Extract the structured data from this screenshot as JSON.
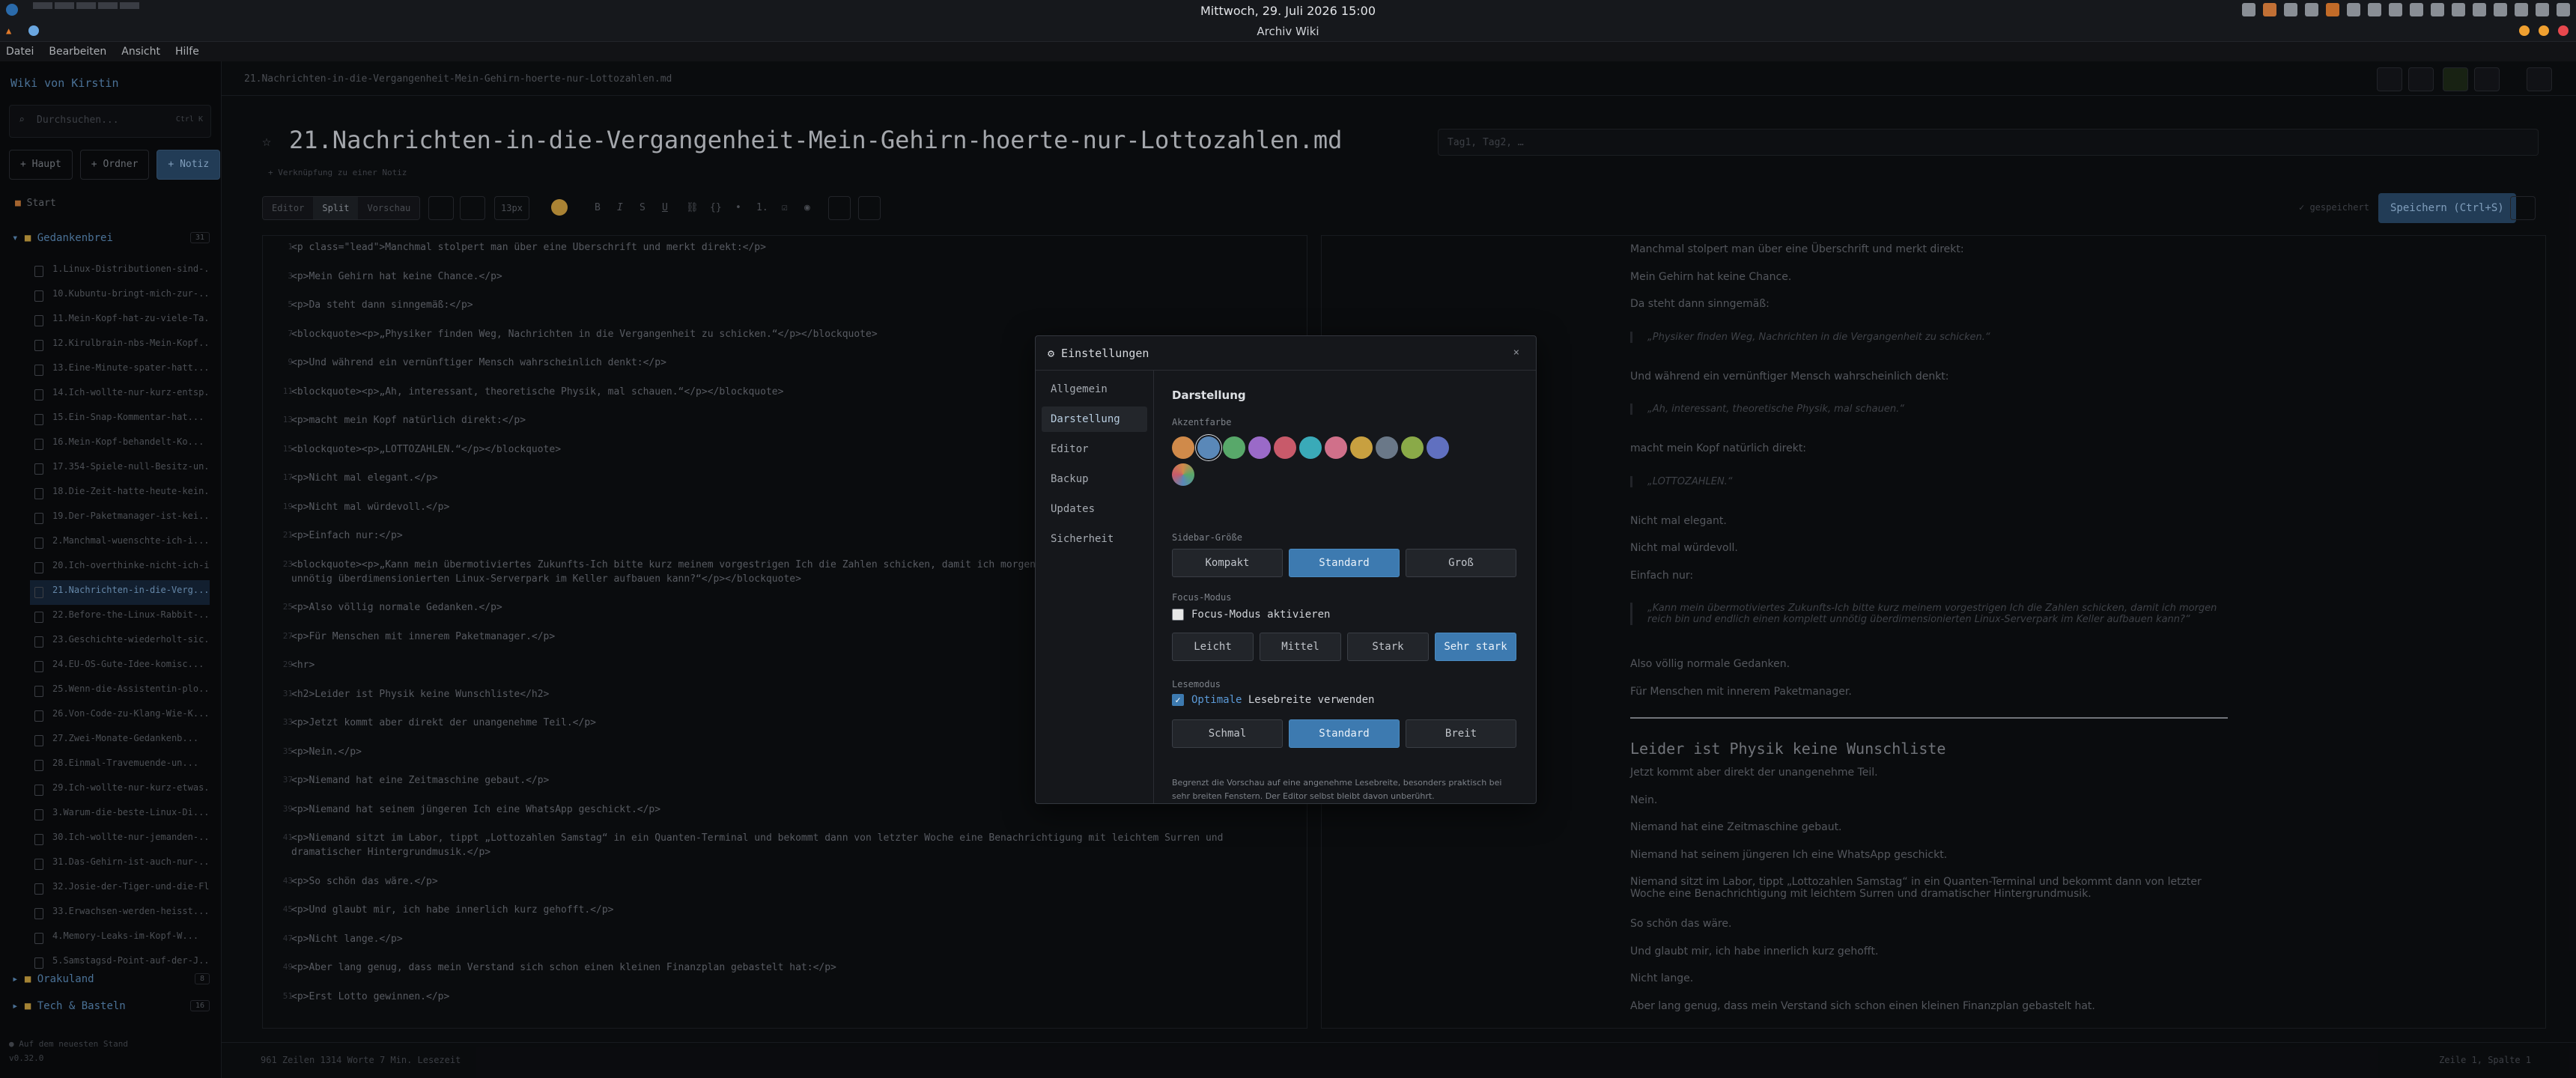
{
  "system": {
    "clock": "Mittwoch, 29. Juli 2026 15:00"
  },
  "window": {
    "title": "Archiv Wiki"
  },
  "menu": [
    "Datei",
    "Bearbeiten",
    "Ansicht",
    "Hilfe"
  ],
  "sidebar": {
    "wiki_title": "Wiki von Kirstin",
    "search_placeholder": "Durchsuchen...",
    "search_shortcut": "Ctrl K",
    "buttons": [
      "+ Haupt",
      "+ Ordner",
      "+ Notiz"
    ],
    "start": "Start",
    "groups": [
      {
        "name": "Gedankenbrei",
        "count": "31"
      },
      {
        "name": "Orakuland",
        "count": "8"
      },
      {
        "name": "Tech & Basteln",
        "count": "16"
      }
    ],
    "files": [
      "1.Linux-Distributionen-sind-...",
      "10.Kubuntu-bringt-mich-zur-...",
      "11.Mein-Kopf-hat-zu-viele-Ta...",
      "12.Kirulbrain-nbs-Mein-Kopf...",
      "13.Eine-Minute-spater-hatt...",
      "14.Ich-wollte-nur-kurz-entsp...",
      "15.Ein-Snap-Kommentar-hat...",
      "16.Mein-Kopf-behandelt-Ko...",
      "17.354-Spiele-null-Besitz-un...",
      "18.Die-Zeit-hatte-heute-kein...",
      "19.Der-Paketmanager-ist-kei...",
      "2.Manchmal-wuenschte-ich-i...",
      "20.Ich-overthinke-nicht-ich-i...",
      "21.Nachrichten-in-die-Verg...",
      "22.Before-the-Linux-Rabbit-...",
      "23.Geschichte-wiederholt-sic...",
      "24.EU-OS-Gute-Idee-komisc...",
      "25.Wenn-die-Assistentin-plo...",
      "26.Von-Code-zu-Klang-Wie-K...",
      "27.Zwei-Monate-Gedankenb...",
      "28.Einmal-Travemuende-un...",
      "29.Ich-wollte-nur-kurz-etwas...",
      "3.Warum-die-beste-Linux-Di...",
      "30.Ich-wollte-nur-jemanden-...",
      "31.Das-Gehirn-ist-auch-nur-...",
      "32.Josie-der-Tiger-und-die-Fl...",
      "33.Erwachsen-werden-heisst...",
      "4.Memory-Leaks-im-Kopf-W...",
      "5.Samstagsd-Point-auf-der-J..."
    ],
    "footer": [
      "● Auf dem neuesten Stand",
      "v0.32.0"
    ]
  },
  "editor": {
    "breadcrumb": "21.Nachrichten-in-die-Vergangenheit-Mein-Gehirn-hoerte-nur-Lottozahlen.md",
    "title": "21.Nachrichten-in-die-Vergangenheit-Mein-Gehirn-hoerte-nur-Lottozahlen.md",
    "tags_placeholder": "Tag1, Tag2, …",
    "backlink": "+ Verknüpfung zu einer Notiz",
    "modes": [
      "Editor",
      "Split",
      "Vorschau"
    ],
    "fontsize": "13px",
    "saved": "✓ gespeichert",
    "save_button": "Speichern (Ctrl+S)",
    "status_left": "961 Zeilen   1314 Worte   7 Min. Lesezeit",
    "status_right": "Zeile 1, Spalte 1"
  },
  "code_lines": [
    {
      "n": "1",
      "t": "<p class=\"lead\">Manchmal stolpert man über eine Überschrift und merkt direkt:</p>"
    },
    {
      "n": "3",
      "t": "<p>Mein Gehirn hat keine Chance.</p>"
    },
    {
      "n": "5",
      "t": "<p>Da steht dann sinngemäß:</p>"
    },
    {
      "n": "7",
      "t": "<blockquote><p>„Physiker finden Weg, Nachrichten in die Vergangenheit zu schicken.“</p></blockquote>"
    },
    {
      "n": "9",
      "t": "<p>Und während ein vernünftiger Mensch wahrscheinlich denkt:</p>"
    },
    {
      "n": "11",
      "t": "<blockquote><p>„Ah, interessant, theoretische Physik, mal schauen.“</p></blockquote>"
    },
    {
      "n": "13",
      "t": "<p>macht mein Kopf natürlich direkt:</p>"
    },
    {
      "n": "15",
      "t": "<blockquote><p>„LOTTOZAHLEN.“</p></blockquote>"
    },
    {
      "n": "17",
      "t": "<p>Nicht mal elegant.</p>"
    },
    {
      "n": "19",
      "t": "<p>Nicht mal würdevoll.</p>"
    },
    {
      "n": "21",
      "t": "<p>Einfach nur:</p>"
    },
    {
      "n": "23",
      "t": "<blockquote><p>„Kann mein übermotiviertes Zukunfts-Ich bitte kurz meinem vorgestrigen Ich die Zahlen schicken, damit ich morgen"
    },
    {
      "n": "",
      "t": "unnötig überdimensionierten Linux-Serverpark im Keller aufbauen kann?“</p></blockquote>"
    },
    {
      "n": "25",
      "t": "<p>Also völlig normale Gedanken.</p>"
    },
    {
      "n": "27",
      "t": "<p>Für Menschen mit innerem Paketmanager.</p>"
    },
    {
      "n": "29",
      "t": "<hr>"
    },
    {
      "n": "31",
      "t": "<h2>Leider ist Physik keine Wunschliste</h2>"
    },
    {
      "n": "33",
      "t": "<p>Jetzt kommt aber direkt der unangenehme Teil.</p>"
    },
    {
      "n": "35",
      "t": "<p>Nein.</p>"
    },
    {
      "n": "37",
      "t": "<p>Niemand hat eine Zeitmaschine gebaut.</p>"
    },
    {
      "n": "39",
      "t": "<p>Niemand hat seinem jüngeren Ich eine WhatsApp geschickt.</p>"
    },
    {
      "n": "41",
      "t": "<p>Niemand sitzt im Labor, tippt „Lottozahlen Samstag“ in ein Quanten-Terminal und bekommt dann von letzter Woche eine Benachrichtigung mit leichtem Surren und"
    },
    {
      "n": "",
      "t": "dramatischer Hintergrundmusik.</p>"
    },
    {
      "n": "43",
      "t": "<p>So schön das wäre.</p>"
    },
    {
      "n": "45",
      "t": "<p>Und glaubt mir, ich habe innerlich kurz gehofft.</p>"
    },
    {
      "n": "47",
      "t": "<p>Nicht lange.</p>"
    },
    {
      "n": "49",
      "t": "<p>Aber lang genug, dass mein Verstand sich schon einen kleinen Finanzplan gebastelt hat:</p>"
    },
    {
      "n": "51",
      "t": "<p>Erst Lotto gewinnen.</p>"
    }
  ],
  "preview": [
    {
      "k": "p",
      "t": "Manchmal stolpert man über eine Überschrift und merkt direkt:"
    },
    {
      "k": "p",
      "t": "Mein Gehirn hat keine Chance."
    },
    {
      "k": "p",
      "t": "Da steht dann sinngemäß:"
    },
    {
      "k": "bq",
      "t": "„Physiker finden Weg, Nachrichten in die Vergangenheit zu schicken.“"
    },
    {
      "k": "p",
      "t": "Und während ein vernünftiger Mensch wahrscheinlich denkt:"
    },
    {
      "k": "bq",
      "t": "„Ah, interessant, theoretische Physik, mal schauen.“"
    },
    {
      "k": "p",
      "t": "macht mein Kopf natürlich direkt:"
    },
    {
      "k": "bq",
      "t": "„LOTTOZAHLEN.“"
    },
    {
      "k": "p",
      "t": "Nicht mal elegant."
    },
    {
      "k": "p",
      "t": "Nicht mal würdevoll."
    },
    {
      "k": "p",
      "t": "Einfach nur:"
    },
    {
      "k": "bq",
      "t": "„Kann mein übermotiviertes Zukunfts-Ich bitte kurz meinem vorgestrigen Ich die Zahlen schicken, damit ich morgen reich bin und endlich einen komplett unnötig überdimensionierten Linux-Serverpark im Keller aufbauen kann?“"
    },
    {
      "k": "p",
      "t": "Also völlig normale Gedanken."
    },
    {
      "k": "p",
      "t": "Für Menschen mit innerem Paketmanager."
    },
    {
      "k": "h2",
      "t": "Leider ist Physik keine Wunschliste"
    },
    {
      "k": "p",
      "t": "Jetzt kommt aber direkt der unangenehme Teil."
    },
    {
      "k": "p",
      "t": "Nein."
    },
    {
      "k": "p",
      "t": "Niemand hat eine Zeitmaschine gebaut."
    },
    {
      "k": "p",
      "t": "Niemand hat seinem jüngeren Ich eine WhatsApp geschickt."
    },
    {
      "k": "p",
      "t": "Niemand sitzt im Labor, tippt „Lottozahlen Samstag“ in ein Quanten-Terminal und bekommt dann von letzter Woche eine Benachrichtigung mit leichtem Surren und dramatischer Hintergrundmusik."
    },
    {
      "k": "p",
      "t": "So schön das wäre."
    },
    {
      "k": "p",
      "t": "Und glaubt mir, ich habe innerlich kurz gehofft."
    },
    {
      "k": "p",
      "t": "Nicht lange."
    },
    {
      "k": "p",
      "t": "Aber lang genug, dass mein Verstand sich schon einen kleinen Finanzplan gebastelt hat."
    }
  ],
  "dialog": {
    "title": "⚙ Einstellungen",
    "close": "×",
    "nav": [
      "Allgemein",
      "Darstellung",
      "Editor",
      "Backup",
      "Updates",
      "Sicherheit"
    ],
    "heading": "Darstellung",
    "accent_label": "Akzentfarbe",
    "accent_colors": [
      "#d08a4a",
      "#5a88b8",
      "#58a86a",
      "#9a6ac8",
      "#c85a6a",
      "#3aaab8",
      "#d0708a",
      "#c8a040",
      "#6a7888",
      "#8aaa48",
      "#6070c0"
    ],
    "custom_color": "custom-color",
    "sidebar_label": "Sidebar-Größe",
    "sidebar_opts": [
      "Kompakt",
      "Standard",
      "Groß"
    ],
    "focus_label": "Focus-Modus",
    "focus_check": "Focus-Modus aktivieren",
    "focus_opts": [
      "Leicht",
      "Mittel",
      "Stark",
      "Sehr stark"
    ],
    "read_label": "Lesemodus",
    "read_check_accent": "Optimale",
    "read_check_rest": " Lesebreite verwenden",
    "read_opts": [
      "Schmal",
      "Standard",
      "Breit"
    ],
    "note": "Begrenzt die Vorschau auf eine angenehme Lesebreite, besonders praktisch bei sehr breiten Fenstern. Der Editor selbst bleibt davon unberührt."
  }
}
